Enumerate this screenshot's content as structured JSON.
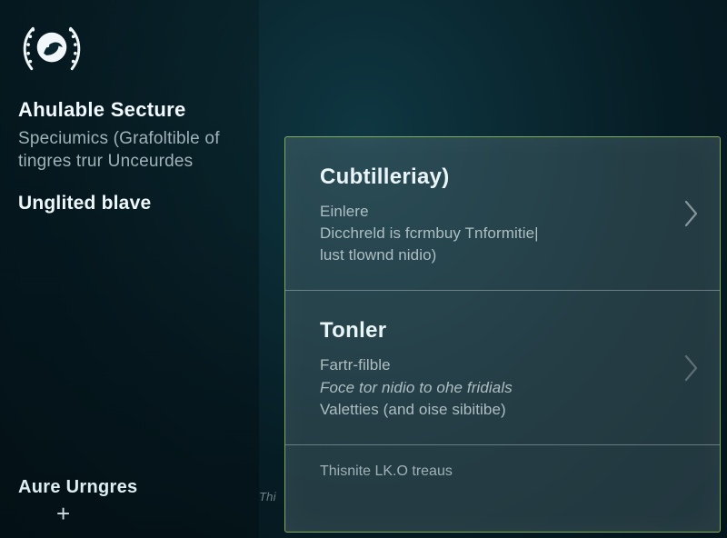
{
  "sidebar": {
    "title": "Ahulable Secture",
    "description": "Speciumics (Grafoltible of tingres trur Unceurdes",
    "selected": "Unglited blave",
    "footer_title": "Aure Urngres",
    "footer_plus": "+"
  },
  "main": {
    "small_label": "Thi",
    "panel": {
      "items": [
        {
          "title": "Cubtilleriay)",
          "lines": [
            {
              "text": "Einlere",
              "italic": false
            },
            {
              "text": "Dicchreld is fcrmbuy Tnformitie|",
              "italic": false
            },
            {
              "text": "lust tlownd nidio)",
              "italic": false
            }
          ]
        },
        {
          "title": "Tonler",
          "lines": [
            {
              "text": "Fartr-filble",
              "italic": false
            },
            {
              "text": "Foce tor nidio to ohe fridials",
              "italic": true
            },
            {
              "text": "Valetties (and oise sibitibe)",
              "italic": false
            }
          ]
        }
      ],
      "peek": "Thisnite LK.O treaus"
    }
  }
}
